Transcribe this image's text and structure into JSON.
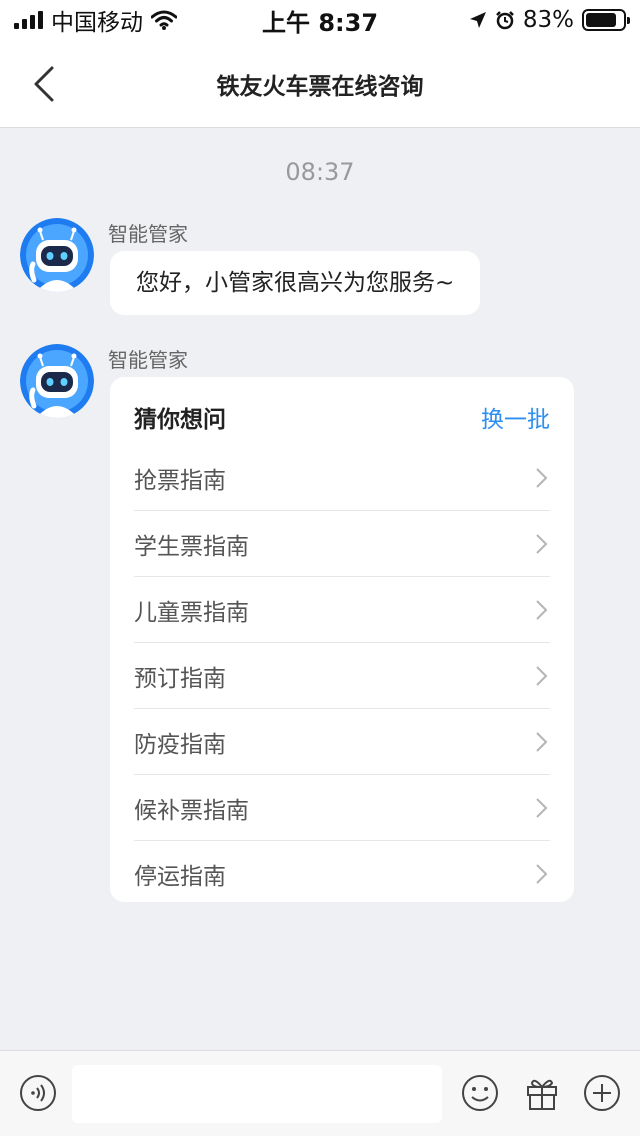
{
  "status_bar": {
    "carrier": "中国移动",
    "time": "上午 8:37",
    "battery_pct": "83%",
    "battery_level": 0.83
  },
  "header": {
    "title": "铁友火车票在线咨询"
  },
  "chat": {
    "time_divider": "08:37",
    "messages": [
      {
        "sender": "智能管家",
        "text": "您好，小管家很高兴为您服务~"
      }
    ],
    "faq_card": {
      "sender": "智能管家",
      "title": "猜你想问",
      "refresh_label": "换一批",
      "items": [
        {
          "label": "抢票指南"
        },
        {
          "label": "学生票指南"
        },
        {
          "label": "儿童票指南"
        },
        {
          "label": "预订指南"
        },
        {
          "label": "防疫指南"
        },
        {
          "label": "候补票指南"
        },
        {
          "label": "停运指南"
        }
      ]
    }
  },
  "input_bar": {
    "placeholder": "",
    "icons": [
      "voice-icon",
      "emoji-icon",
      "gift-icon",
      "plus-icon"
    ]
  },
  "colors": {
    "accent": "#2f8ff0",
    "background": "#eef0f3",
    "avatar_blue": "#1e7cf0"
  }
}
